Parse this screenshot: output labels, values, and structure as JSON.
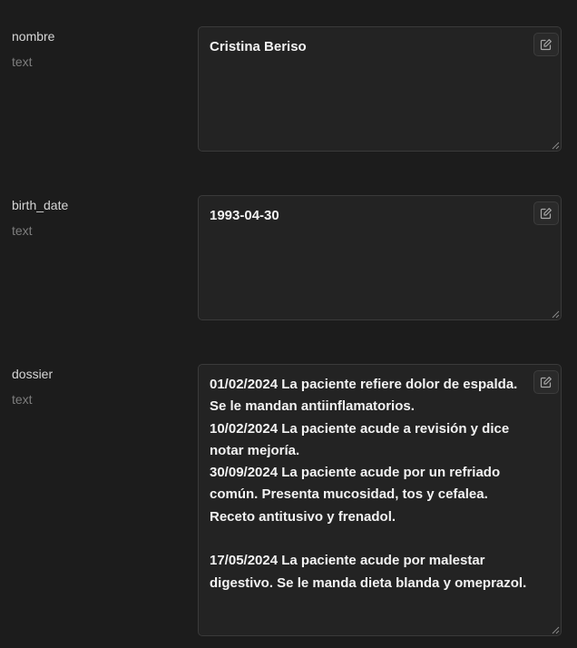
{
  "fields": [
    {
      "name": "nombre",
      "type": "text",
      "value": "Cristina Beriso"
    },
    {
      "name": "birth_date",
      "type": "text",
      "value": "1993-04-30"
    },
    {
      "name": "dossier",
      "type": "text",
      "value": "01/02/2024 La paciente refiere dolor de espalda.\nSe le mandan antiinflamatorios.\n10/02/2024 La paciente acude a revisión y dice notar mejoría.\n30/09/2024 La paciente acude por un refriado común. Presenta mucosidad, tos y cefalea.\nReceto antitusivo y frenadol.\n\n17/05/2024 La paciente acude por malestar digestivo. Se le manda dieta blanda y omeprazol."
    }
  ],
  "icons": {
    "edit": "edit-icon",
    "resize": "resize-handle-icon"
  },
  "colors": {
    "background": "#1c1c1c",
    "box_background": "#232323",
    "border": "#3a3a3a",
    "label": "#d6d6d6",
    "type": "#7d7d7d",
    "value": "#f2f2f2"
  }
}
